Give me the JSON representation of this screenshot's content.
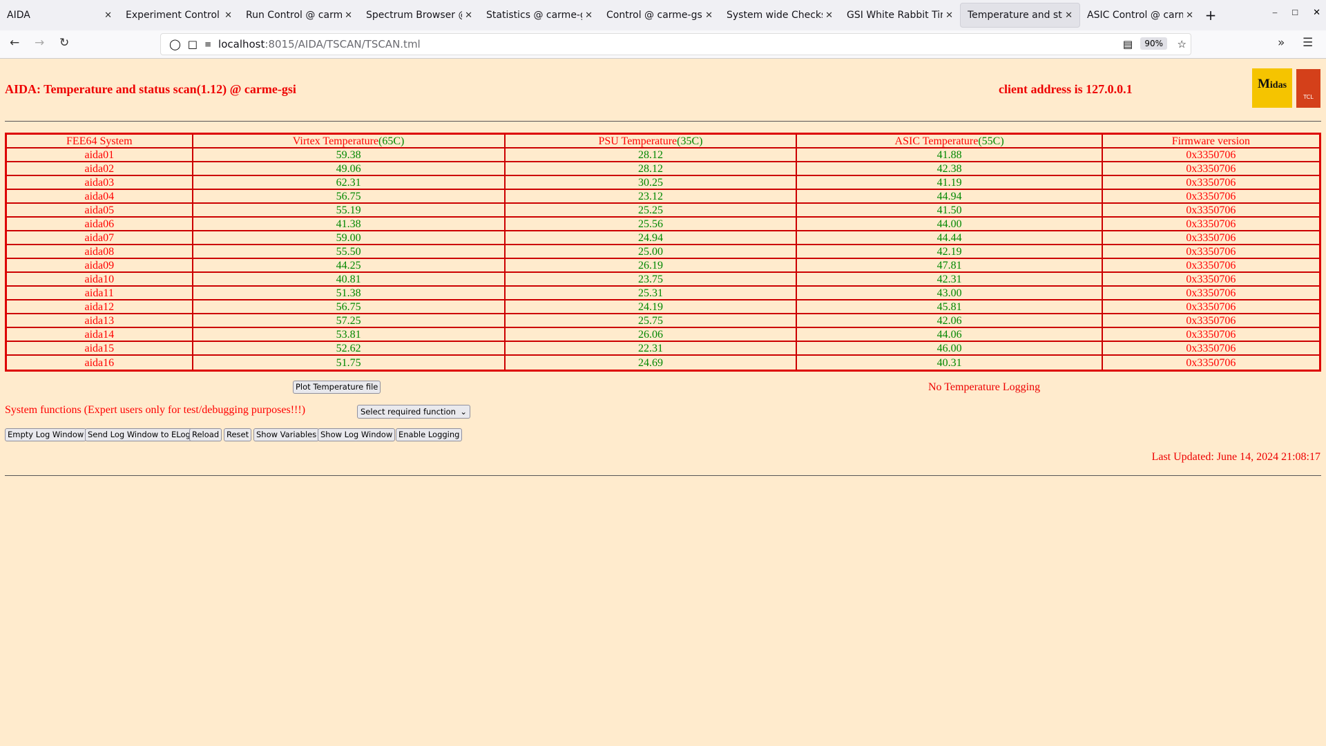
{
  "browser": {
    "tabs": [
      {
        "label": "AIDA",
        "active": false
      },
      {
        "label": "Experiment Control @",
        "active": false
      },
      {
        "label": "Run Control @ carme",
        "active": false
      },
      {
        "label": "Spectrum Browser @",
        "active": false
      },
      {
        "label": "Statistics @ carme-g",
        "active": false
      },
      {
        "label": "Control @ carme-gsi",
        "active": false
      },
      {
        "label": "System wide Checks (",
        "active": false
      },
      {
        "label": "GSI White Rabbit Tim",
        "active": false
      },
      {
        "label": "Temperature and stat",
        "active": true
      },
      {
        "label": "ASIC Control @ carm",
        "active": false
      }
    ],
    "url_host": "localhost",
    "url_path": ":8015/AIDA/TSCAN/TSCAN.tml",
    "zoom": "90%"
  },
  "page": {
    "title": "AIDA: Temperature and status scan(1.12) @ carme-gsi",
    "client_address": "client address is 127.0.0.1",
    "logos": {
      "midas": "Midas",
      "tcl": "TCL POWERED"
    },
    "table": {
      "headers": [
        {
          "label": "FEE64 System",
          "limit": ""
        },
        {
          "label": "Virtex Temperature",
          "limit": "(65C)"
        },
        {
          "label": "PSU Temperature",
          "limit": "(35C)"
        },
        {
          "label": "ASIC Temperature",
          "limit": "(55C)"
        },
        {
          "label": "Firmware version",
          "limit": ""
        }
      ],
      "rows": [
        [
          "aida01",
          "59.38",
          "28.12",
          "41.88",
          "0x3350706"
        ],
        [
          "aida02",
          "49.06",
          "28.12",
          "42.38",
          "0x3350706"
        ],
        [
          "aida03",
          "62.31",
          "30.25",
          "41.19",
          "0x3350706"
        ],
        [
          "aida04",
          "56.75",
          "23.12",
          "44.94",
          "0x3350706"
        ],
        [
          "aida05",
          "55.19",
          "25.25",
          "41.50",
          "0x3350706"
        ],
        [
          "aida06",
          "41.38",
          "25.56",
          "44.00",
          "0x3350706"
        ],
        [
          "aida07",
          "59.00",
          "24.94",
          "44.44",
          "0x3350706"
        ],
        [
          "aida08",
          "55.50",
          "25.00",
          "42.19",
          "0x3350706"
        ],
        [
          "aida09",
          "44.25",
          "26.19",
          "47.81",
          "0x3350706"
        ],
        [
          "aida10",
          "40.81",
          "23.75",
          "42.31",
          "0x3350706"
        ],
        [
          "aida11",
          "51.38",
          "25.31",
          "43.00",
          "0x3350706"
        ],
        [
          "aida12",
          "56.75",
          "24.19",
          "45.81",
          "0x3350706"
        ],
        [
          "aida13",
          "57.25",
          "25.75",
          "42.06",
          "0x3350706"
        ],
        [
          "aida14",
          "53.81",
          "26.06",
          "44.06",
          "0x3350706"
        ],
        [
          "aida15",
          "52.62",
          "22.31",
          "46.00",
          "0x3350706"
        ],
        [
          "aida16",
          "51.75",
          "24.69",
          "40.31",
          "0x3350706"
        ]
      ]
    },
    "plot_button": "Plot Temperature file",
    "no_logging": "No Temperature Logging",
    "system_functions": "System functions (Expert users only for test/debugging purposes!!!)",
    "select_value": "Select required function",
    "buttons": [
      "Empty Log Window",
      "Send Log Window to ELog",
      "Reload",
      "Reset",
      "Show Variables",
      "Show Log Window",
      "Enable Logging"
    ],
    "last_updated": "Last Updated: June 14, 2024 21:08:17"
  },
  "colors": {
    "background": "#ffebcd",
    "text_red": "#ff0000",
    "value_green": "#008800",
    "table_border": "#dd0000"
  }
}
